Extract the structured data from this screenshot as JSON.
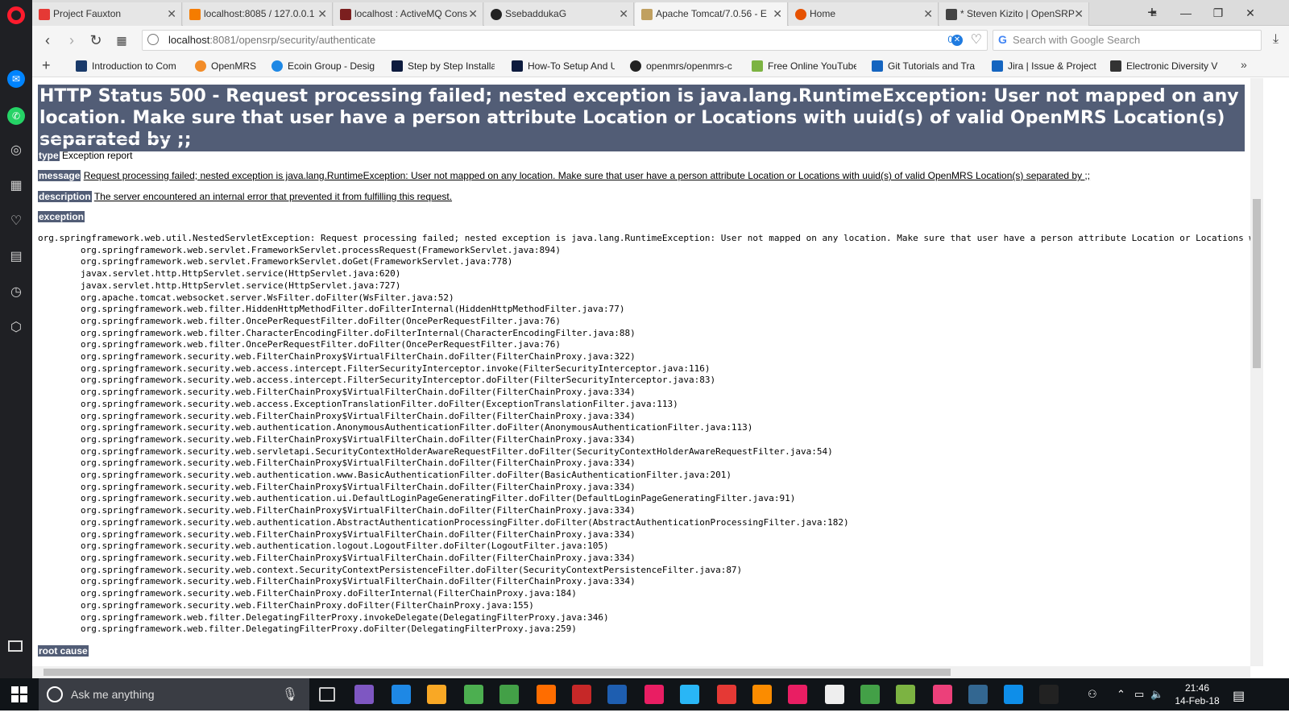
{
  "tabs": [
    {
      "label": "Project Fauxton",
      "color": "#e53935"
    },
    {
      "label": "localhost:8085 / 127.0.0.1",
      "color": "#f57c00"
    },
    {
      "label": "localhost : ActiveMQ Cons",
      "color": "#7b1f1f"
    },
    {
      "label": "SsebaddukaG",
      "color": "#222222"
    },
    {
      "label": "Apache Tomcat/7.0.56 - E",
      "color": "#c0a060"
    },
    {
      "label": "Home",
      "color": "#e65100"
    },
    {
      "label": "* Steven Kizito | OpenSRP",
      "color": "#444444"
    }
  ],
  "address": {
    "host": "localhost",
    "path": ":8081/opensrp/security/authenticate",
    "badge": "0"
  },
  "search": {
    "placeholder": "Search with Google Search"
  },
  "bookmarks": [
    {
      "label": "Introduction to Com",
      "color": "#1a3a6a"
    },
    {
      "label": "OpenMRS",
      "color": "#f28c28"
    },
    {
      "label": "Ecoin Group - Desig",
      "color": "#1e88e5"
    },
    {
      "label": "Step by Step Installa",
      "color": "#0d1b3e"
    },
    {
      "label": "How-To Setup And U",
      "color": "#0d1b3e"
    },
    {
      "label": "openmrs/openmrs-c",
      "color": "#222222"
    },
    {
      "label": "Free Online YouTube",
      "color": "#7cb342"
    },
    {
      "label": "Git Tutorials and Tra",
      "color": "#1565c0"
    },
    {
      "label": "Jira | Issue & Project",
      "color": "#1565c0"
    },
    {
      "label": "Electronic Diversity V",
      "color": "#333333"
    }
  ],
  "error": {
    "title": "HTTP Status 500 - Request processing failed; nested exception is java.lang.RuntimeException: User not mapped on any location. Make sure that user have a person attribute Location or Locations with uuid(s) of valid OpenMRS Location(s) separated by ;;",
    "type_label": "type",
    "type_value": "Exception report",
    "message_label": "message",
    "message_value": "Request processing failed; nested exception is java.lang.RuntimeException: User not mapped on any location. Make sure that user have a person attribute Location or Locations with uuid(s) of valid OpenMRS Location(s) separated by ;;",
    "description_label": "description",
    "description_value": "The server encountered an internal error that prevented it from fulfilling this request.",
    "exception_label": "exception",
    "stack": "org.springframework.web.util.NestedServletException: Request processing failed; nested exception is java.lang.RuntimeException: User not mapped on any location. Make sure that user have a person attribute Location or Locations with uuid(s) of valid OpenMRS Location(s) separated by ;;\n\torg.springframework.web.servlet.FrameworkServlet.processRequest(FrameworkServlet.java:894)\n\torg.springframework.web.servlet.FrameworkServlet.doGet(FrameworkServlet.java:778)\n\tjavax.servlet.http.HttpServlet.service(HttpServlet.java:620)\n\tjavax.servlet.http.HttpServlet.service(HttpServlet.java:727)\n\torg.apache.tomcat.websocket.server.WsFilter.doFilter(WsFilter.java:52)\n\torg.springframework.web.filter.HiddenHttpMethodFilter.doFilterInternal(HiddenHttpMethodFilter.java:77)\n\torg.springframework.web.filter.OncePerRequestFilter.doFilter(OncePerRequestFilter.java:76)\n\torg.springframework.web.filter.CharacterEncodingFilter.doFilterInternal(CharacterEncodingFilter.java:88)\n\torg.springframework.web.filter.OncePerRequestFilter.doFilter(OncePerRequestFilter.java:76)\n\torg.springframework.security.web.FilterChainProxy$VirtualFilterChain.doFilter(FilterChainProxy.java:322)\n\torg.springframework.security.web.access.intercept.FilterSecurityInterceptor.invoke(FilterSecurityInterceptor.java:116)\n\torg.springframework.security.web.access.intercept.FilterSecurityInterceptor.doFilter(FilterSecurityInterceptor.java:83)\n\torg.springframework.security.web.FilterChainProxy$VirtualFilterChain.doFilter(FilterChainProxy.java:334)\n\torg.springframework.security.web.access.ExceptionTranslationFilter.doFilter(ExceptionTranslationFilter.java:113)\n\torg.springframework.security.web.FilterChainProxy$VirtualFilterChain.doFilter(FilterChainProxy.java:334)\n\torg.springframework.security.web.authentication.AnonymousAuthenticationFilter.doFilter(AnonymousAuthenticationFilter.java:113)\n\torg.springframework.security.web.FilterChainProxy$VirtualFilterChain.doFilter(FilterChainProxy.java:334)\n\torg.springframework.security.web.servletapi.SecurityContextHolderAwareRequestFilter.doFilter(SecurityContextHolderAwareRequestFilter.java:54)\n\torg.springframework.security.web.FilterChainProxy$VirtualFilterChain.doFilter(FilterChainProxy.java:334)\n\torg.springframework.security.web.authentication.www.BasicAuthenticationFilter.doFilter(BasicAuthenticationFilter.java:201)\n\torg.springframework.security.web.FilterChainProxy$VirtualFilterChain.doFilter(FilterChainProxy.java:334)\n\torg.springframework.security.web.authentication.ui.DefaultLoginPageGeneratingFilter.doFilter(DefaultLoginPageGeneratingFilter.java:91)\n\torg.springframework.security.web.FilterChainProxy$VirtualFilterChain.doFilter(FilterChainProxy.java:334)\n\torg.springframework.security.web.authentication.AbstractAuthenticationProcessingFilter.doFilter(AbstractAuthenticationProcessingFilter.java:182)\n\torg.springframework.security.web.FilterChainProxy$VirtualFilterChain.doFilter(FilterChainProxy.java:334)\n\torg.springframework.security.web.authentication.logout.LogoutFilter.doFilter(LogoutFilter.java:105)\n\torg.springframework.security.web.FilterChainProxy$VirtualFilterChain.doFilter(FilterChainProxy.java:334)\n\torg.springframework.security.web.context.SecurityContextPersistenceFilter.doFilter(SecurityContextPersistenceFilter.java:87)\n\torg.springframework.security.web.FilterChainProxy$VirtualFilterChain.doFilter(FilterChainProxy.java:334)\n\torg.springframework.security.web.FilterChainProxy.doFilterInternal(FilterChainProxy.java:184)\n\torg.springframework.security.web.FilterChainProxy.doFilter(FilterChainProxy.java:155)\n\torg.springframework.web.filter.DelegatingFilterProxy.invokeDelegate(DelegatingFilterProxy.java:346)\n\torg.springframework.web.filter.DelegatingFilterProxy.doFilter(DelegatingFilterProxy.java:259)",
    "root_cause_label": "root cause"
  },
  "taskbar": {
    "search_placeholder": "Ask me anything",
    "time": "21:46",
    "date": "14-Feb-18",
    "apps": [
      {
        "name": "cortana-app-icon",
        "color": "#7e57c2"
      },
      {
        "name": "edge-icon",
        "color": "#1e88e5"
      },
      {
        "name": "file-explorer-icon",
        "color": "#f9a825"
      },
      {
        "name": "store-icon",
        "color": "#4caf50"
      },
      {
        "name": "hotspot-icon",
        "color": "#43a047"
      },
      {
        "name": "firefox-icon",
        "color": "#ff6d00"
      },
      {
        "name": "game-icon",
        "color": "#c62828"
      },
      {
        "name": "word-icon",
        "color": "#1e5eb0"
      },
      {
        "name": "intellij-icon",
        "color": "#e91e63"
      },
      {
        "name": "window-icon",
        "color": "#29b6f6"
      },
      {
        "name": "opera-icon",
        "color": "#e53935"
      },
      {
        "name": "xampp-icon",
        "color": "#fb8c00"
      },
      {
        "name": "flickr-icon",
        "color": "#e91e63"
      },
      {
        "name": "mail-icon",
        "color": "#eeeeee"
      },
      {
        "name": "sync-icon",
        "color": "#43a047"
      },
      {
        "name": "android-icon",
        "color": "#7cb342"
      },
      {
        "name": "music-icon",
        "color": "#ec407a"
      },
      {
        "name": "postgres-icon",
        "color": "#336791"
      },
      {
        "name": "teamviewer-icon",
        "color": "#0e8ee9"
      },
      {
        "name": "terminal-icon",
        "color": "#222222"
      }
    ]
  }
}
